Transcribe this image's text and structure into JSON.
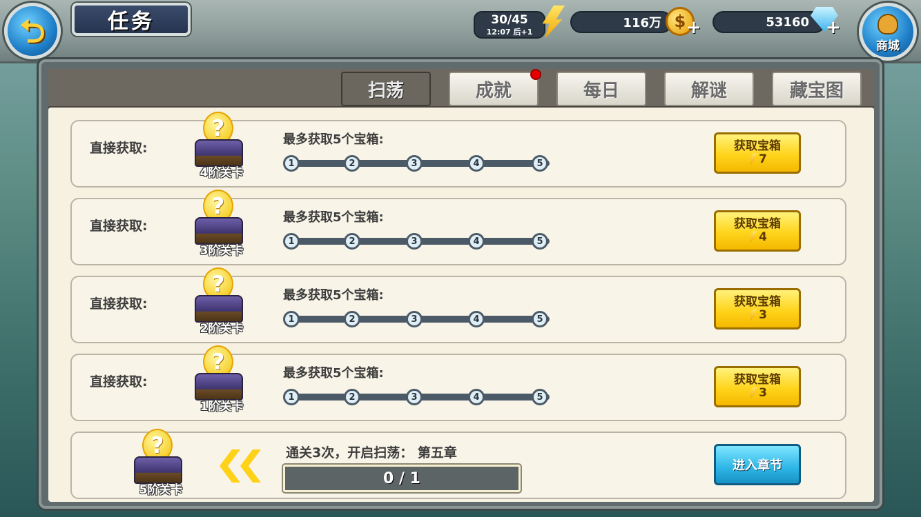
{
  "header": {
    "title": "任务",
    "energy": {
      "value": "30/45",
      "timer": "12:07 后+1"
    },
    "gold": "116万",
    "gems": "53160",
    "shop_label": "商城"
  },
  "tabs": [
    {
      "label": "扫荡",
      "active": true
    },
    {
      "label": "成就",
      "badge": true
    },
    {
      "label": "每日"
    },
    {
      "label": "解谜"
    },
    {
      "label": "藏宝图"
    }
  ],
  "rows": [
    {
      "direct_label": "直接获取:",
      "level": "4阶关卡",
      "max_text": "最多获取5个宝箱:",
      "nodes": [
        "1",
        "2",
        "3",
        "4",
        "5"
      ],
      "button": {
        "line1": "获取宝箱",
        "cost": "7"
      }
    },
    {
      "direct_label": "直接获取:",
      "level": "3阶关卡",
      "max_text": "最多获取5个宝箱:",
      "nodes": [
        "1",
        "2",
        "3",
        "4",
        "5"
      ],
      "button": {
        "line1": "获取宝箱",
        "cost": "4"
      }
    },
    {
      "direct_label": "直接获取:",
      "level": "2阶关卡",
      "max_text": "最多获取5个宝箱:",
      "nodes": [
        "1",
        "2",
        "3",
        "4",
        "5"
      ],
      "button": {
        "line1": "获取宝箱",
        "cost": "3"
      }
    },
    {
      "direct_label": "直接获取:",
      "level": "1阶关卡",
      "max_text": "最多获取5个宝箱:",
      "nodes": [
        "1",
        "2",
        "3",
        "4",
        "5"
      ],
      "button": {
        "line1": "获取宝箱",
        "cost": "3"
      }
    }
  ],
  "locked_row": {
    "level": "5阶关卡",
    "pass_text": "通关3次，开启扫荡：  第五章",
    "progress": "0 / 1",
    "progress_fraction": 0,
    "button": "进入章节"
  },
  "colors": {
    "accent_yellow": "#ffd41c",
    "accent_blue": "#2cb5e6",
    "badge_red": "#e80000"
  }
}
